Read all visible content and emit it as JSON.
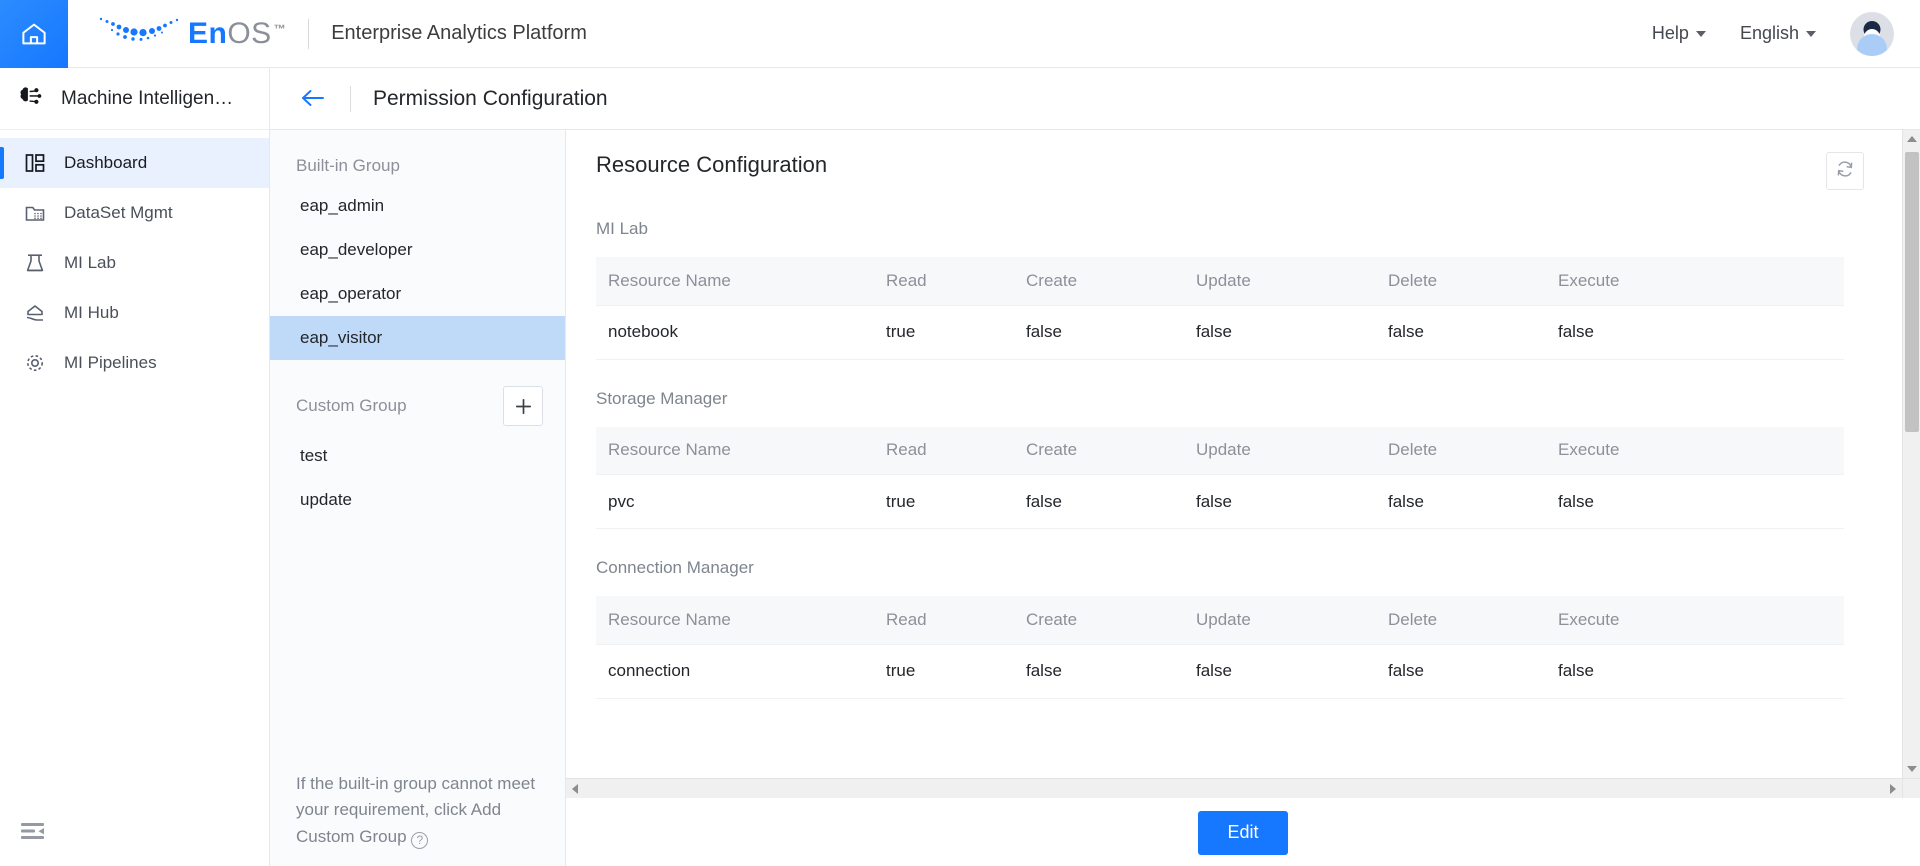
{
  "header": {
    "home_icon": "home-icon",
    "brand_en": "En",
    "brand_os": "OS",
    "brand_tm": "™",
    "product_name": "Enterprise Analytics Platform",
    "help_label": "Help",
    "language_label": "English",
    "avatar_alt": "user-avatar"
  },
  "sidebar": {
    "module_title": "Machine Intelligen…",
    "items": [
      {
        "label": "Dashboard",
        "icon": "dashboard-icon",
        "active": true
      },
      {
        "label": "DataSet Mgmt",
        "icon": "dataset-icon",
        "active": false
      },
      {
        "label": "MI Lab",
        "icon": "flask-icon",
        "active": false
      },
      {
        "label": "MI Hub",
        "icon": "hub-icon",
        "active": false
      },
      {
        "label": "MI Pipelines",
        "icon": "pipeline-icon",
        "active": false
      }
    ],
    "collapse_icon": "collapse-sidebar-icon"
  },
  "pagehead": {
    "back_icon": "back-arrow-icon",
    "title": "Permission Configuration"
  },
  "groups": {
    "builtin_label": "Built-in Group",
    "builtin_items": [
      {
        "label": "eap_admin",
        "selected": false
      },
      {
        "label": "eap_developer",
        "selected": false
      },
      {
        "label": "eap_operator",
        "selected": false
      },
      {
        "label": "eap_visitor",
        "selected": true
      }
    ],
    "custom_label": "Custom Group",
    "add_button_label": "+",
    "custom_items": [
      {
        "label": "test",
        "selected": false
      },
      {
        "label": "update",
        "selected": false
      }
    ],
    "hint_text": "If the built-in group cannot meet your requirement, click Add Custom Group",
    "hint_icon": "question-circle-icon"
  },
  "content": {
    "title": "Resource Configuration",
    "refresh_icon": "refresh-icon",
    "columns": [
      "Resource Name",
      "Read",
      "Create",
      "Update",
      "Delete",
      "Execute"
    ],
    "sections": [
      {
        "name": "MI Lab",
        "rows": [
          {
            "resource": "notebook",
            "read": "true",
            "create": "false",
            "update": "false",
            "delete": "false",
            "execute": "false"
          }
        ]
      },
      {
        "name": "Storage Manager",
        "rows": [
          {
            "resource": "pvc",
            "read": "true",
            "create": "false",
            "update": "false",
            "delete": "false",
            "execute": "false"
          }
        ]
      },
      {
        "name": "Connection Manager",
        "rows": [
          {
            "resource": "connection",
            "read": "true",
            "create": "false",
            "update": "false",
            "delete": "false",
            "execute": "false"
          }
        ]
      }
    ],
    "edit_button_label": "Edit"
  },
  "colors": {
    "accent": "#1677ff",
    "selected_group_bg": "#bedaf8",
    "active_nav_bg": "#e9f1fe",
    "table_header_bg": "#f7f8fa",
    "panel_bg": "#fafbfc"
  }
}
